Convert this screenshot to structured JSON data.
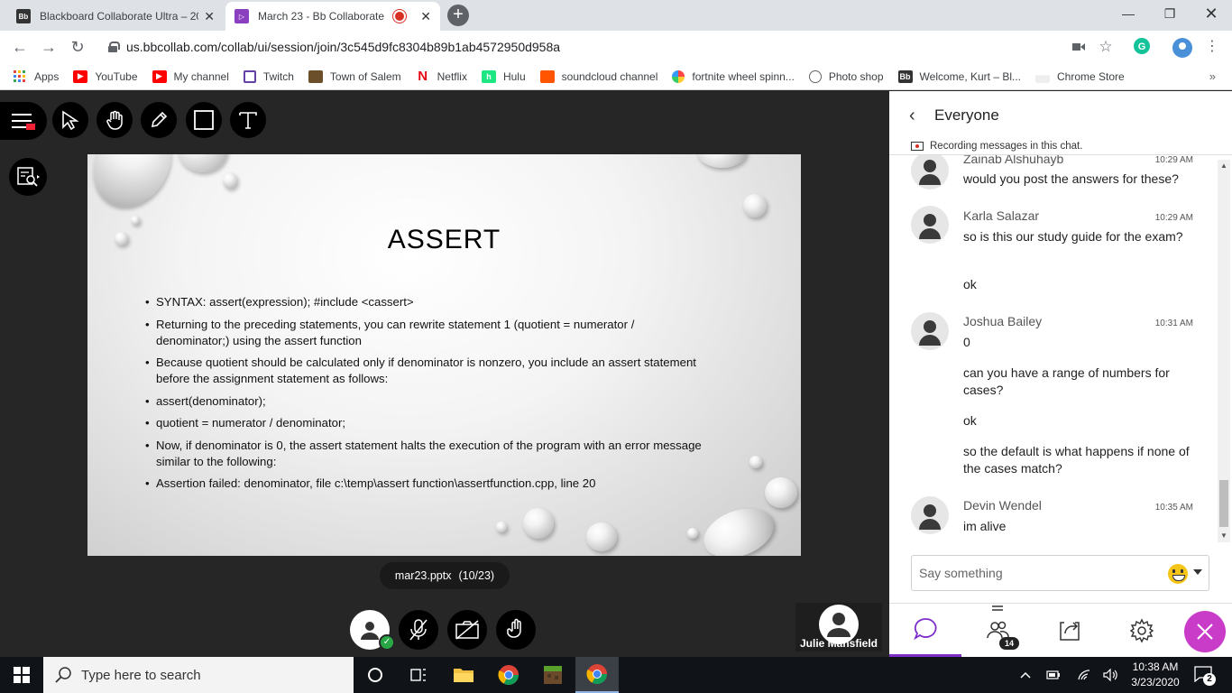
{
  "browser": {
    "tabs": [
      {
        "title": "Blackboard Collaborate Ultra – 20",
        "favicon": "Bb",
        "active": false
      },
      {
        "title": "March 23 - Bb Collaborate",
        "favicon": "Bb",
        "active": true,
        "recording": true
      }
    ],
    "url": "us.bbcollab.com/collab/ui/session/join/3c545d9fc8304b89b1ab4572950d958a",
    "bookmarks": [
      {
        "label": "Apps",
        "icon": "apps-grid-icon"
      },
      {
        "label": "YouTube",
        "icon": "youtube-icon"
      },
      {
        "label": "My channel",
        "icon": "youtube-icon"
      },
      {
        "label": "Twitch",
        "icon": "twitch-icon"
      },
      {
        "label": "Town of Salem",
        "icon": "town-of-salem-icon"
      },
      {
        "label": "Netflix",
        "icon": "netflix-icon"
      },
      {
        "label": "Hulu",
        "icon": "hulu-icon"
      },
      {
        "label": "soundcloud channel",
        "icon": "soundcloud-icon"
      },
      {
        "label": "fortnite wheel spinn...",
        "icon": "wheel-icon"
      },
      {
        "label": "Photo shop",
        "icon": "globe-icon"
      },
      {
        "label": "Welcome, Kurt – Bl...",
        "icon": "blackboard-icon"
      },
      {
        "label": "Chrome Store",
        "icon": "chrome-store-icon"
      }
    ]
  },
  "slide": {
    "title": "ASSERT",
    "bullets": [
      "SYNTAX: assert(expression); #include <cassert>",
      "Returning to the preceding statements, you can rewrite statement 1 (quotient = numerator / denominator;) using the assert function",
      "Because quotient should be calculated only if denominator is nonzero, you include an assert statement before the assignment statement as follows:",
      "assert(denominator);",
      "quotient = numerator / denominator;",
      "Now, if denominator is 0, the assert statement halts the execution of the program with an error message similar to the following:",
      "Assertion failed: denominator, file c:\\temp\\assert function\\assertfunction.cpp, line 20"
    ],
    "file_name": "mar23.pptx",
    "page_indicator": "(10/23)"
  },
  "presenter": {
    "name": "Julie Mansfield"
  },
  "chat": {
    "title": "Everyone",
    "recording_notice": "Recording messages in this chat.",
    "messages": [
      {
        "name": "Zainab Alshuhayb",
        "time": "10:29 AM",
        "lines": [
          "would you post the answers for these?"
        ]
      },
      {
        "name": "Karla Salazar",
        "time": "10:29 AM",
        "lines": [
          "so is this our study guide for the exam?",
          "ok"
        ]
      },
      {
        "name": "Joshua Bailey",
        "time": "10:31 AM",
        "lines": [
          "0",
          "can you have a range of numbers for cases?",
          "ok",
          "so the default is what happens if none of the cases match?"
        ]
      },
      {
        "name": "Devin Wendel",
        "time": "10:35 AM",
        "lines": [
          "im alive"
        ]
      }
    ],
    "input_placeholder": "Say something",
    "participant_count": "14"
  },
  "taskbar": {
    "search_placeholder": "Type here to search",
    "time": "10:38 AM",
    "date": "3/23/2020",
    "notification_count": "2"
  },
  "colors": {
    "accent_purple": "#7d2ec9",
    "close_magenta": "#c83cc8",
    "status_green": "#27a844"
  }
}
